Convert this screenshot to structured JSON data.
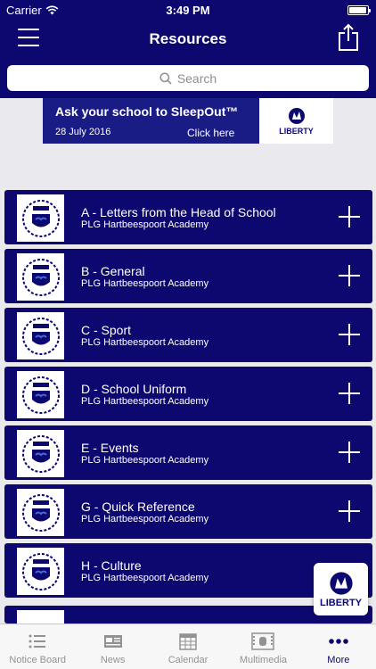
{
  "status_bar": {
    "carrier": "Carrier",
    "time": "3:49 PM"
  },
  "nav": {
    "title": "Resources"
  },
  "search": {
    "placeholder": "Search"
  },
  "banner": {
    "headline": "Ask your school to SleepOut™",
    "date": "28 July 2016",
    "cta": "Click here",
    "brand": "LIBERTY"
  },
  "items": [
    {
      "title": "A - Letters from the Head of School",
      "subtitle": "PLG Hartbeespoort Academy"
    },
    {
      "title": "B - General",
      "subtitle": "PLG Hartbeespoort Academy"
    },
    {
      "title": "C - Sport",
      "subtitle": "PLG Hartbeespoort Academy"
    },
    {
      "title": "D - School Uniform",
      "subtitle": "PLG Hartbeespoort Academy"
    },
    {
      "title": "E - Events",
      "subtitle": "PLG Hartbeespoort Academy"
    },
    {
      "title": "G - Quick Reference",
      "subtitle": "PLG Hartbeespoort Academy"
    },
    {
      "title": "H - Culture",
      "subtitle": "PLG Hartbeespoort Academy"
    }
  ],
  "floating_logo": {
    "brand": "LIBERTY"
  },
  "tabs": [
    {
      "label": "Notice Board",
      "icon": "list-icon"
    },
    {
      "label": "News",
      "icon": "newspaper-icon"
    },
    {
      "label": "Calendar",
      "icon": "calendar-icon"
    },
    {
      "label": "Multimedia",
      "icon": "film-icon"
    },
    {
      "label": "More",
      "icon": "more-icon"
    }
  ],
  "colors": {
    "primary": "#0d0870",
    "active_tab": "#0d0870",
    "inactive_tab": "#929292"
  }
}
